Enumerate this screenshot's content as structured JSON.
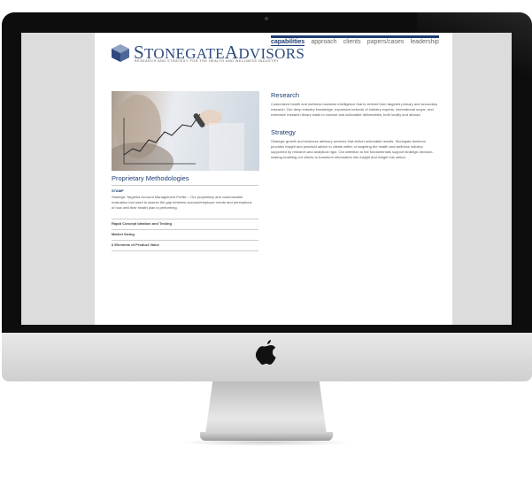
{
  "site": {
    "logo": {
      "name_first_cap": "S",
      "name_first": "TONEGATE",
      "name_second_cap": "A",
      "name_second": "DVISORS",
      "tagline": "RESEARCH AND STRATEGY FOR THE HEALTH AND WELLNESS INDUSTRY"
    },
    "nav": [
      "capabilities",
      "approach",
      "clients",
      "papers/cases",
      "leadership"
    ],
    "methodologies": {
      "title": "Proprietary Methodologies",
      "stamp_label": "STAMP",
      "stamp_description": "Strategic Targeted Account Management Profile – Our proprietary and customizable evaluation tool used to assess the gap between account/employer needs and perceptions of how well their health plan is performing.",
      "items": [
        "Rapid Concept Ideation and Testing",
        "Market Sizing",
        "6 Elements of Product Value"
      ]
    },
    "research": {
      "title": "Research",
      "body": "Customized health and wellness business intelligence that is derived from targeted primary and secondary research. Our deep industry knowledge, expansive network of industry experts, international scope, and extensive research library leads to concise and actionable deliverables, both locally and abroad."
    },
    "strategy": {
      "title": "Strategy",
      "body": "Strategic growth and business advisory services that deliver actionable results. Stonegate Advisors provides insight and practical advice to clients within or targeting the health and wellness industry supported by research and analytical rigor. Our attention to the fundamentals support strategic decision-making enabling our clients to transform information into insight and insight into action."
    }
  },
  "colors": {
    "brand": "#1e3d73",
    "bezel": "#0d0d0d",
    "screen_bg": "#dcdcdc"
  },
  "icons": {
    "apple": "apple-logo-icon",
    "logo_mark": "stonegate-cube-icon"
  }
}
